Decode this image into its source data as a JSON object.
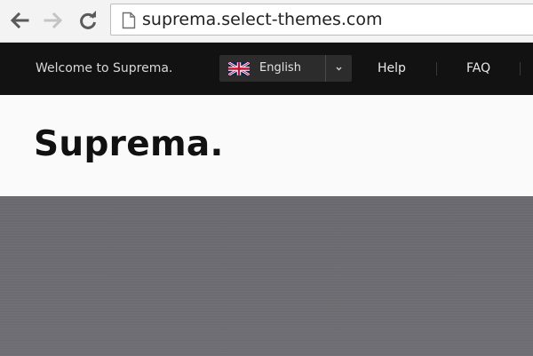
{
  "browser": {
    "url": "suprema.select-themes.com",
    "icons": [
      "back-arrow-icon",
      "forward-arrow-icon",
      "reload-icon",
      "page-icon"
    ]
  },
  "topbar": {
    "welcome": "Welcome to Suprema.",
    "language": {
      "label": "English",
      "flag": "uk-flag-icon",
      "chevron": "chevron-down-icon"
    },
    "links": [
      "Help",
      "FAQ"
    ]
  },
  "header": {
    "logo": "Suprema."
  },
  "colors": {
    "topbar_bg": "#121212",
    "header_bg": "#fafafa",
    "hero_bg": "#6c6c72",
    "lang_select_bg": "#2c2c2c"
  }
}
